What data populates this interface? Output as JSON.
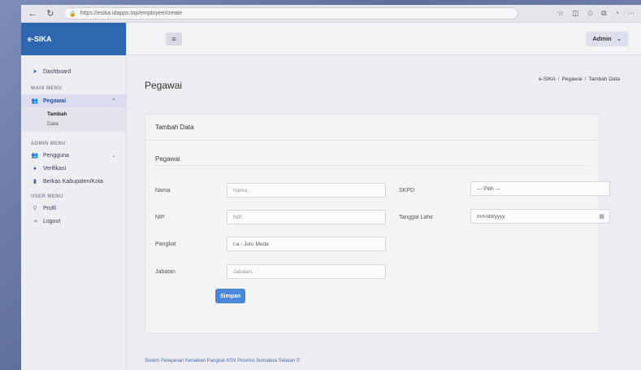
{
  "browser": {
    "url": "https://esika.idapps.top/employee/create",
    "back_icon": "back-arrow",
    "reload_icon": "reload"
  },
  "app": {
    "brand": "e-SIKA",
    "admin_label": "Admin"
  },
  "sidebar": {
    "dashboard": "Dashboard",
    "main_menu": "MAIN MENU",
    "pegawai": "Pegawai",
    "sub_tambah": "Tambah",
    "sub_data": "Data",
    "admin_menu": "ADMIN MENU",
    "pengguna": "Pengguna",
    "verifikasi": "Verifikasi",
    "berkas": "Berkas Kabupaten/Kota",
    "user_menu": "USER MENU",
    "profil": "Profil",
    "logout": "Logout"
  },
  "page": {
    "title": "Pegawai",
    "breadcrumb": [
      "e-SIKA",
      "Pegawai",
      "Tambah Data"
    ]
  },
  "form": {
    "card_title": "Tambah Data",
    "section": "Pegawai",
    "nama_label": "Nama",
    "nama_placeholder": "Nama..",
    "nip_label": "NIP",
    "nip_placeholder": "NIP..",
    "pangkat_label": "Pangkat",
    "pangkat_value": "I.a - Juru Muda",
    "jabatan_label": "Jabatan",
    "jabatan_placeholder": "Jabatan..",
    "skpd_label": "SKPD",
    "skpd_value": "--- Pilih ---",
    "tgl_label": "Tanggal Lahir",
    "tgl_placeholder": "mm/dd/yyyy",
    "submit": "Simpan"
  },
  "footer": "Sistem Pelayanan Kenaikan Pangkat ASN Provinsi Sumatera Selatan ©",
  "colors": {
    "brand": "#2f66b0",
    "primary_button": "#4a86d8"
  }
}
